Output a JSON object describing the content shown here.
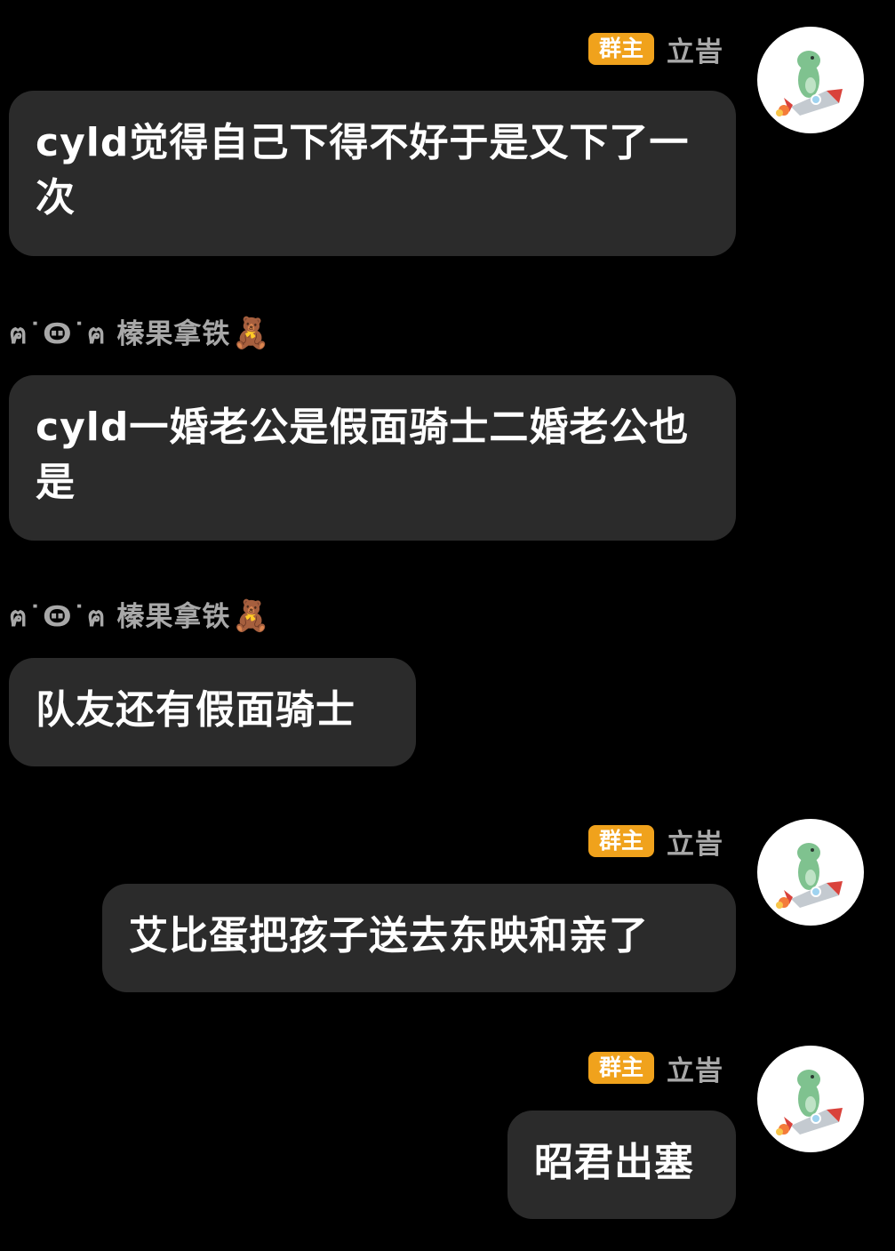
{
  "messages": [
    {
      "side": "right",
      "sender": {
        "badge": "群主",
        "name": "立峕"
      },
      "text": "cyld觉得自己下得不好于是又下了一次"
    },
    {
      "side": "left",
      "sender": {
        "name": "ฅ˙Ꙫ˙ฅ 榛果拿铁",
        "emoji": "🧸"
      },
      "text": "cyld一婚老公是假面骑士二婚老公也是"
    },
    {
      "side": "left",
      "sender": {
        "name": "ฅ˙Ꙫ˙ฅ 榛果拿铁",
        "emoji": "🧸"
      },
      "text": "队友还有假面骑士"
    },
    {
      "side": "right",
      "sender": {
        "badge": "群主",
        "name": "立峕"
      },
      "text": "艾比蛋把孩子送去东映和亲了"
    },
    {
      "side": "right",
      "sender": {
        "badge": "群主",
        "name": "立峕"
      },
      "text": "昭君出塞"
    }
  ],
  "avatar_icon": "dinosaur-rocket-avatar-icon",
  "colors": {
    "background": "#000000",
    "bubble": "#2b2b2b",
    "badge": "#f0a21c",
    "sender_name": "#a8a8a8"
  }
}
